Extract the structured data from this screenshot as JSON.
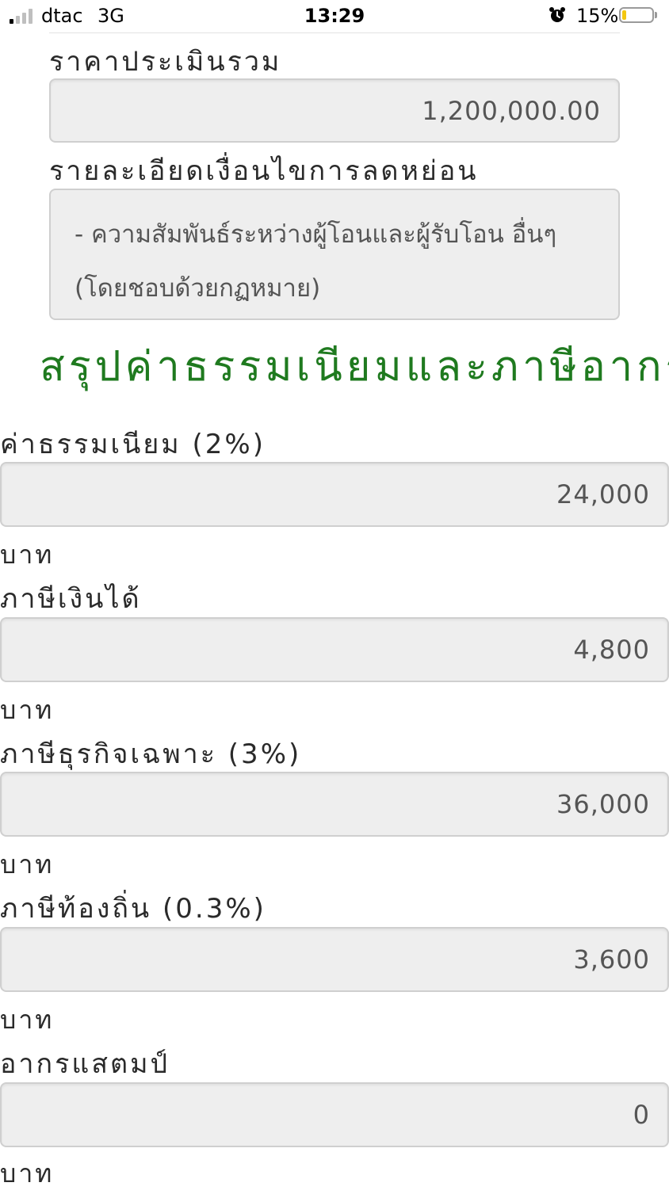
{
  "status_bar": {
    "carrier": "dtac",
    "network": "3G",
    "time": "13:29",
    "battery_percent": "15%",
    "battery_level": 0.15,
    "alarm_icon": "alarm-clock-icon"
  },
  "appraisal": {
    "label": "ราคาประเมินรวม",
    "value": "1,200,000.00"
  },
  "discount_details": {
    "label": "รายละเอียดเงื่อนไขการลดหย่อน",
    "lines": [
      "- ความสัมพันธ์ระหว่างผู้โอนและผู้รับโอน อื่นๆ",
      "(โดยชอบด้วยกฏหมาย)"
    ]
  },
  "summary_title": "สรุปค่าธรรมเนียมและภาษีอากร",
  "fees": [
    {
      "label": "ค่าธรรมเนียม (2%)",
      "value": "24,000",
      "unit": "บาท"
    },
    {
      "label": "ภาษีเงินได้",
      "value": "4,800",
      "unit": "บาท"
    },
    {
      "label": "ภาษีธุรกิจเฉพาะ (3%)",
      "value": "36,000",
      "unit": "บาท"
    },
    {
      "label": "ภาษีท้องถิ่น (0.3%)",
      "value": "3,600",
      "unit": "บาท"
    },
    {
      "label": "อากรแสตมป์",
      "value": "0",
      "unit": "บาท"
    }
  ],
  "colors": {
    "title_green": "#1f7a1f",
    "field_bg": "#eeeeee",
    "battery_yellow": "#f3c710"
  }
}
